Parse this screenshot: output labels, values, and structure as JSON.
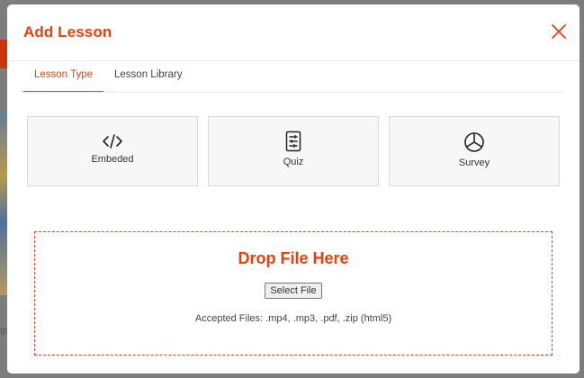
{
  "modal": {
    "title": "Add Lesson",
    "close_icon": "close-icon"
  },
  "tabs": [
    {
      "label": "Lesson Type",
      "active": true
    },
    {
      "label": "Lesson Library",
      "active": false
    }
  ],
  "lesson_types": [
    {
      "label": "Embeded",
      "icon": "code-icon"
    },
    {
      "label": "Quiz",
      "icon": "quiz-icon"
    },
    {
      "label": "Survey",
      "icon": "pie-chart-icon"
    }
  ],
  "dropzone": {
    "title": "Drop File Here",
    "button_label": "Select File",
    "accepted": "Accepted Files: .mp4, .mp3, .pdf, .zip (html5)"
  },
  "background": {
    "partial_text": "gs"
  },
  "colors": {
    "accent": "#e8400c",
    "dashed_border": "#d9432a"
  }
}
